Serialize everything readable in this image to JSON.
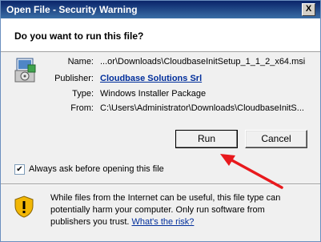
{
  "window": {
    "title": "Open File - Security Warning",
    "close_glyph": "X"
  },
  "header": {
    "question": "Do you want to run this file?"
  },
  "details": {
    "name_label": "Name:",
    "name_value": "...or\\Downloads\\CloudbaseInitSetup_1_1_2_x64.msi",
    "publisher_label": "Publisher:",
    "publisher_value": "Cloudbase Solutions Srl",
    "type_label": "Type:",
    "type_value": "Windows Installer Package",
    "from_label": "From:",
    "from_value": "C:\\Users\\Administrator\\Downloads\\CloudbaseInitS..."
  },
  "buttons": {
    "run": "Run",
    "cancel": "Cancel"
  },
  "options": {
    "always_ask_label": "Always ask before opening this file",
    "always_ask_checked": true,
    "check_glyph": "✔"
  },
  "footer": {
    "warning_text": "While files from the Internet can be useful, this file type can potentially harm your computer. Only run software from publishers you trust.",
    "risk_link": "What's the risk?"
  },
  "colors": {
    "title_bar": "#0a246a",
    "link": "#002e9b",
    "annotation_arrow": "#e8191d"
  },
  "icons": {
    "file": "msi-installer-icon",
    "warning": "security-shield-icon"
  }
}
